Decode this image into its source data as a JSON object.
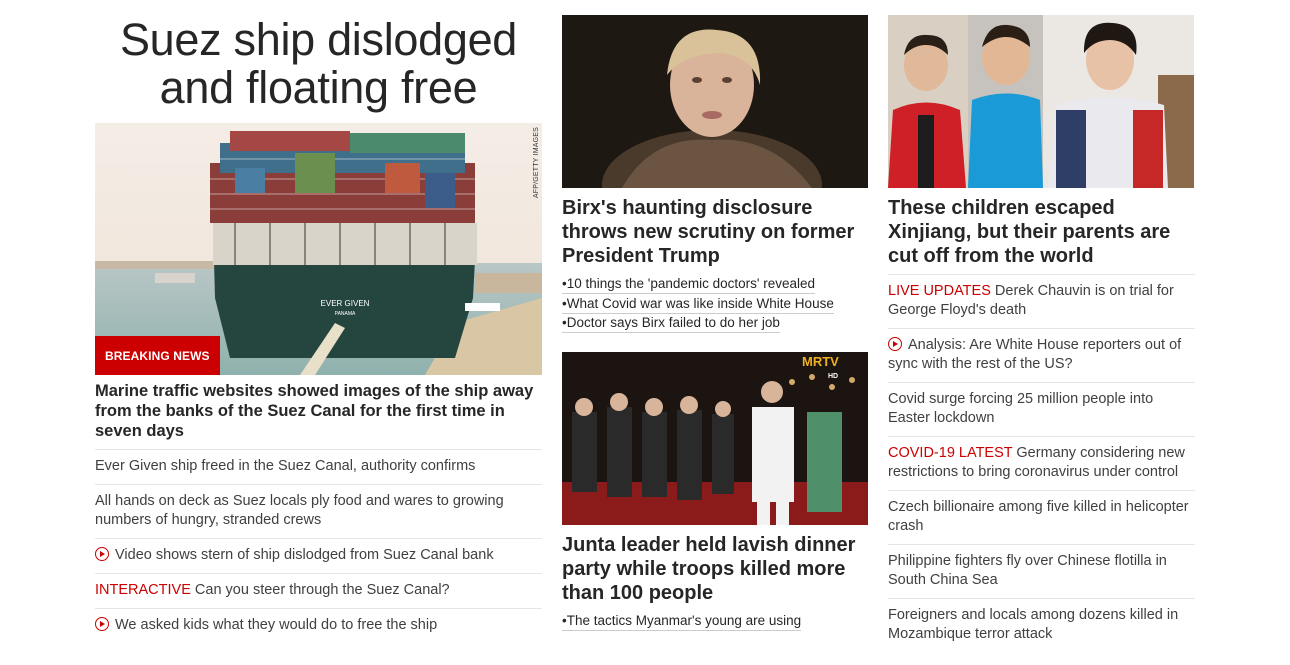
{
  "col1": {
    "headline_line1": "Suez ship dislodged",
    "headline_line2": "and floating free",
    "photo_credit": "AFP/GETTY IMAGES",
    "badge": "BREAKING NEWS",
    "ship_name": "EVER GIVEN",
    "ship_port": "PANAMA",
    "subheadline": "Marine traffic websites showed images of the ship away from the banks of the Suez Canal for the first time in seven days",
    "items": [
      {
        "tag": "",
        "icon": "",
        "text": "Ever Given ship freed in the Suez Canal, authority confirms"
      },
      {
        "tag": "",
        "icon": "",
        "text": "All hands on deck as Suez locals ply food and wares to growing numbers of hungry, stranded crews"
      },
      {
        "tag": "",
        "icon": "play-icon",
        "text": "Video shows stern of ship dislodged from Suez Canal bank"
      },
      {
        "tag": "INTERACTIVE",
        "icon": "",
        "text": "Can you steer through the Suez Canal?"
      },
      {
        "tag": "",
        "icon": "play-icon",
        "text": "We asked kids what they would do to free the ship"
      }
    ]
  },
  "col2": {
    "card1": {
      "headline": "Birx's haunting disclosure throws new scrutiny on former President Trump",
      "bullets": [
        "10 things the 'pandemic doctors' revealed",
        "What Covid war was like inside White House",
        "Doctor says Birx failed to do her job"
      ]
    },
    "card2": {
      "logo": "MRTV",
      "logo_sub": "HD",
      "headline": "Junta leader held lavish dinner party while troops killed more than 100 people",
      "bullets": [
        "The tactics Myanmar's young are using"
      ]
    }
  },
  "col3": {
    "headline": "These children escaped Xinjiang, but their parents are cut off from the world",
    "items": [
      {
        "tag": "LIVE UPDATES",
        "icon": "",
        "text": "Derek Chauvin is on trial for George Floyd's death"
      },
      {
        "tag": "",
        "icon": "play-icon",
        "text": "Analysis: Are White House reporters out of sync with the rest of the US?"
      },
      {
        "tag": "",
        "icon": "",
        "text": "Covid surge forcing 25 million people into Easter lockdown"
      },
      {
        "tag": "COVID-19 LATEST",
        "icon": "",
        "text": "Germany considering new restrictions to bring coronavirus under control"
      },
      {
        "tag": "",
        "icon": "",
        "text": "Czech billionaire among five killed in helicopter crash"
      },
      {
        "tag": "",
        "icon": "",
        "text": "Philippine fighters fly over Chinese flotilla in South China Sea"
      },
      {
        "tag": "",
        "icon": "",
        "text": "Foreigners and locals among dozens killed in Mozambique terror attack"
      }
    ]
  },
  "colors": {
    "accent": "#cc0000",
    "text": "#262626",
    "divider": "#e6e6e6"
  }
}
